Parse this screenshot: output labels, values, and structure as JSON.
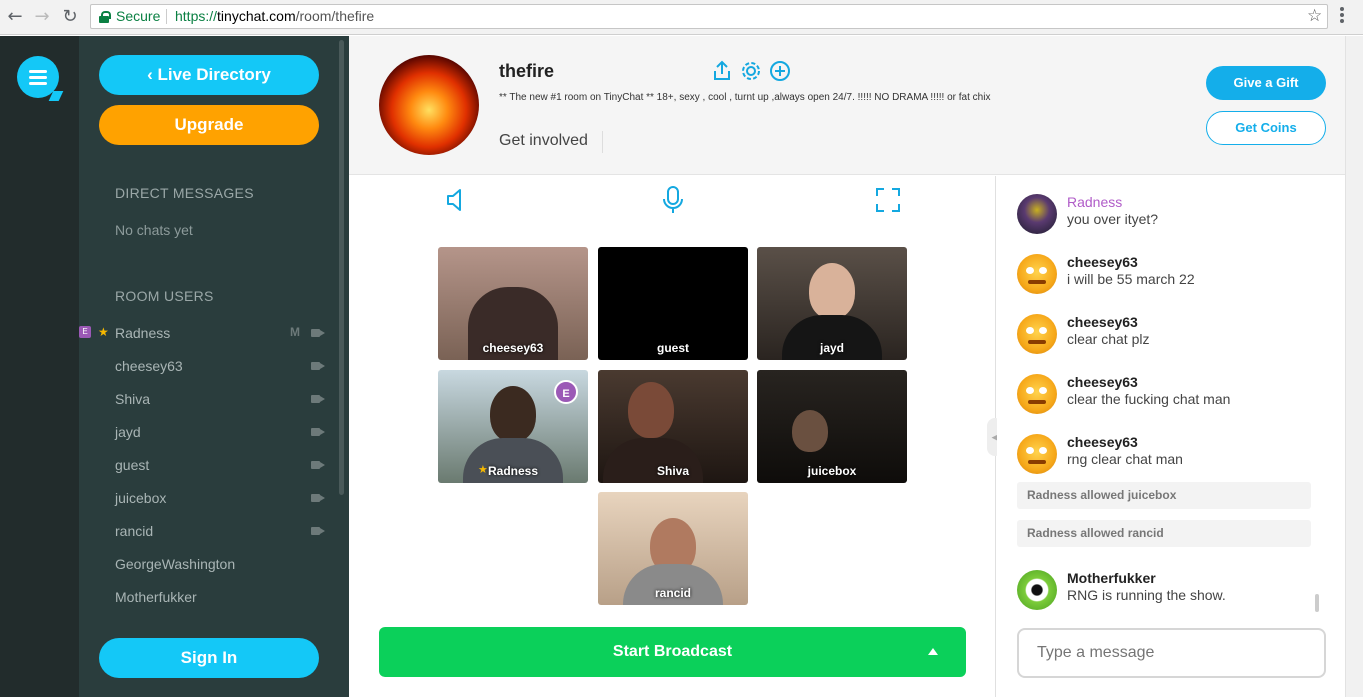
{
  "browser": {
    "back_icon": "back-arrow-icon",
    "forward_icon": "forward-arrow-icon",
    "reload_icon": "reload-icon",
    "secure_label": "Secure",
    "url_scheme": "https://",
    "url_host": "tinychat.com",
    "url_path": "/room/thefire"
  },
  "sidebar": {
    "live_directory": "Live Directory",
    "upgrade": "Upgrade",
    "direct_messages_title": "DIRECT MESSAGES",
    "no_chats": "No chats yet",
    "room_users_title": "ROOM USERS",
    "users": [
      {
        "name": "Radness",
        "badge": "E",
        "star": "★",
        "mic": "M"
      },
      {
        "name": "cheesey63"
      },
      {
        "name": "Shiva"
      },
      {
        "name": "jayd"
      },
      {
        "name": "guest"
      },
      {
        "name": "juicebox"
      },
      {
        "name": "rancid"
      },
      {
        "name": "GeorgeWashington"
      },
      {
        "name": "Motherfukker"
      }
    ],
    "sign_in": "Sign In"
  },
  "room": {
    "name": "thefire",
    "description": "** The new #1 room on TinyChat ** 18+, sexy , cool , turnt up ,always open 24/7. !!!!! NO DRAMA !!!!! or fat chix",
    "get_involved": "Get involved",
    "give_gift": "Give a Gift",
    "get_coins": "Get Coins"
  },
  "videos": [
    {
      "name": "cheesey63"
    },
    {
      "name": "guest"
    },
    {
      "name": "jayd"
    },
    {
      "name": "Radness",
      "badge": "E",
      "star": "★"
    },
    {
      "name": "Shiva"
    },
    {
      "name": "juicebox"
    },
    {
      "name": "rancid"
    }
  ],
  "broadcast_label": "Start Broadcast",
  "chat": {
    "messages": [
      {
        "user": "Radness",
        "text": "you over ityet?",
        "color": "#b05cc8"
      },
      {
        "user": "cheesey63",
        "text": "i will be 55 march 22"
      },
      {
        "user": "cheesey63",
        "text": "clear chat plz"
      },
      {
        "user": "cheesey63",
        "text": "clear the fucking chat man"
      },
      {
        "user": "cheesey63",
        "text": "rng clear chat man"
      }
    ],
    "system": [
      "Radness allowed juicebox",
      "Radness allowed rancid"
    ],
    "last": {
      "user": "Motherfukker",
      "text": "RNG is running the show."
    },
    "input_placeholder": "Type a message"
  },
  "colors": {
    "accent": "#14aeea",
    "upgrade": "#ffa200",
    "broadcast": "#0bd05a",
    "sidebar": "#2a3d3d"
  }
}
